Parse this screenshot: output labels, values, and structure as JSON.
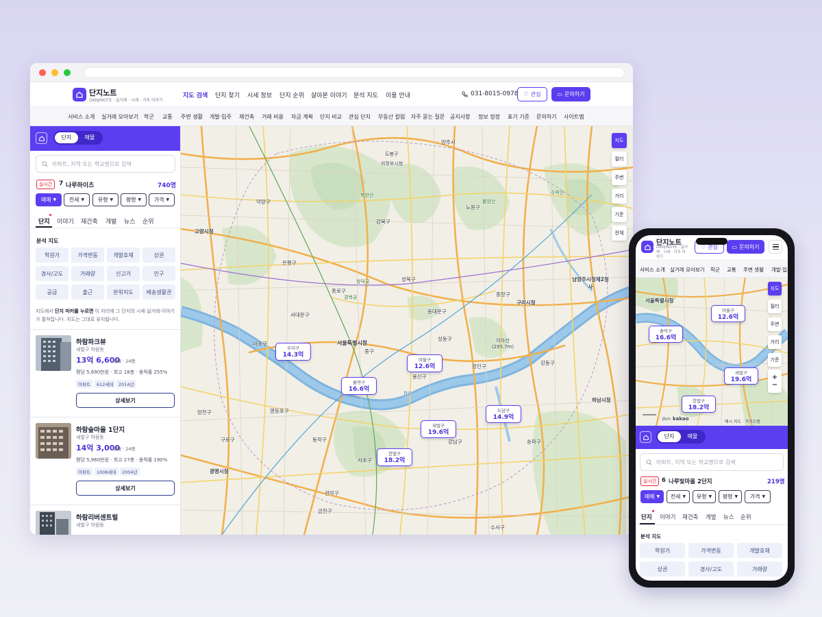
{
  "brand": {
    "name": "단지노트",
    "tagline": "DANJINOTE · 실거래 · 시세 · 거주 이야기",
    "tagline_mobile": "DANJINOTE · 실거래 · 시세 · 거주 이야기"
  },
  "nav": [
    "지도 검색",
    "단지 찾기",
    "시세 정보",
    "단지 순위",
    "살아본 이야기",
    "분석 지도",
    "이용 안내"
  ],
  "phone": "031-8015-0978",
  "buttons": {
    "favorite": "관심",
    "inquiry": "문의하기",
    "detail": "상세보기"
  },
  "subnav": [
    "서비스 소개",
    "실거래 모아보기",
    "학군",
    "교통",
    "주변 생활",
    "개발·입주",
    "재건축",
    "거래 비용",
    "자금 계획",
    "단지 비교",
    "관심 단지",
    "부동산 칼럼",
    "자주 묻는 질문",
    "공지사항",
    "정보 정정",
    "표기 기준",
    "문의하기",
    "사이트맵"
  ],
  "sidebar": {
    "toggle": [
      "단지",
      "매물"
    ],
    "search_placeholder": "아파트, 지역 또는 학교명으로 검색",
    "live_label": "실시간",
    "rank": "7",
    "rank_name": "나루하이츠",
    "rank_count": "740명",
    "filters": [
      "매매",
      "전세",
      "유형",
      "평형",
      "가격"
    ],
    "tabs": [
      "단지",
      "이야기",
      "재건축",
      "개발",
      "뉴스",
      "순위"
    ],
    "analysis_title": "분석 지도",
    "analysis": [
      "학원가",
      "가격변동",
      "개발호재",
      "상권",
      "경사/고도",
      "거래량",
      "신고가",
      "인구",
      "공급",
      "출근",
      "분위지도",
      "배송생활권"
    ],
    "hint_pre": "지도에서 ",
    "hint_strong": "단지 마커를 누르면",
    "hint_post": " 이 자리에 그 단지의 시세·실거래·이야기가 펼쳐집니다. 지도는 그대로 유지됩니다.",
    "listings": [
      {
        "name": "하람파크뷰",
        "loc": "새벌구 하람동",
        "price": "13억 6,600",
        "unit": "매매 · 24평",
        "meta": "평당 5,690만원 · 최고 18층 · 용적률 255%",
        "tags": [
          "아파트",
          "612세대",
          "2014년"
        ]
      },
      {
        "name": "하람숲마을 1단지",
        "loc": "새벌구 하람동",
        "price": "14억 3,000",
        "unit": "매매 · 24평",
        "meta": "평당 5,960만원 · 최고 27층 · 용적률 190%",
        "tags": [
          "아파트",
          "1008세대",
          "2004년"
        ]
      },
      {
        "name": "하람리버센트럴",
        "loc": "새벌구 하람동"
      }
    ]
  },
  "map": {
    "tools": [
      "지도",
      "필터",
      "주변",
      "거리",
      "기준",
      "전체"
    ],
    "markers": [
      {
        "name": "우이구",
        "value": "14.3억"
      },
      {
        "name": "여울구",
        "value": "12.6억"
      },
      {
        "name": "솔악구",
        "value": "16.6억"
      },
      {
        "name": "도담구",
        "value": "14.9억"
      },
      {
        "name": "새벌구",
        "value": "19.6억"
      },
      {
        "name": "한별구",
        "value": "18.2억"
      }
    ],
    "labels": [
      "도봉구",
      "노원구",
      "강북구",
      "성북구",
      "은평구",
      "종로구",
      "서대문구",
      "서울특별시청",
      "중구",
      "동대문구",
      "중랑구",
      "광진구",
      "강동구",
      "마포구",
      "영등포구",
      "구로구",
      "동작구",
      "관악구",
      "서초구",
      "강남구",
      "송파구",
      "광명시청",
      "구리시청",
      "남양주시청제2청사",
      "하남시청",
      "양천구",
      "금천구",
      "수서구",
      "성동구",
      "아차산 (295.7m)",
      "북한산",
      "불암산",
      "경복궁",
      "창덕궁",
      "용산구",
      "한강",
      "양주시",
      "의정부시청",
      "덕양구",
      "고양시청",
      "수락산"
    ]
  },
  "mobile": {
    "subnav": [
      "서비스 소개",
      "실거래 모아보기",
      "학군",
      "교통",
      "주변 생활",
      "개발·입주"
    ],
    "tools": [
      "지도",
      "필터",
      "주변",
      "거리",
      "기준"
    ],
    "markers": [
      {
        "name": "여울구",
        "value": "12.6억"
      },
      {
        "name": "솔악구",
        "value": "16.6억"
      },
      {
        "name": "새벌구",
        "value": "19.6억"
      },
      {
        "name": "한별구",
        "value": "18.2억"
      }
    ],
    "map_labels": [
      "서울특별시청",
      "예시 지도 · 카카오맵",
      "2km",
      "kakao"
    ],
    "rank": "6",
    "rank_name": "나루빛마을 2단지",
    "rank_count": "219명",
    "analysis": [
      "학원가",
      "가격변동",
      "개발호재",
      "상권",
      "경사/고도",
      "거래량"
    ]
  },
  "colors": {
    "accent": "#5b3ef0",
    "live": "#e0283a",
    "river": "#6aa9d8",
    "park": "#cfe2c2"
  }
}
